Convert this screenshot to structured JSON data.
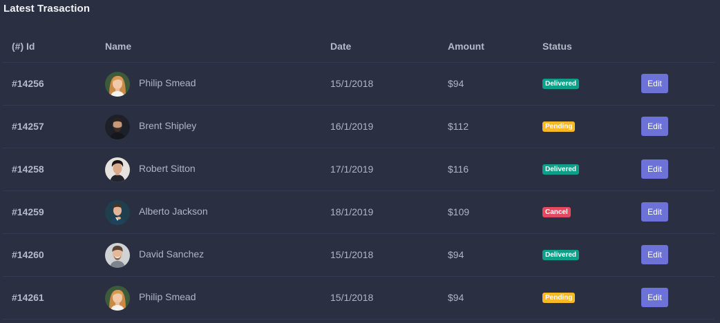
{
  "card": {
    "title": "Latest Trasaction"
  },
  "table": {
    "headers": {
      "id": "(#) Id",
      "name": "Name",
      "date": "Date",
      "amount": "Amount",
      "status": "Status"
    },
    "rows": [
      {
        "id": "#14256",
        "name": "Philip Smead",
        "date": "15/1/2018",
        "amount": "$94",
        "status": "Delivered",
        "status_kind": "delivered",
        "action": "Edit",
        "avatar": "woman-blonde"
      },
      {
        "id": "#14257",
        "name": "Brent Shipley",
        "date": "16/1/2019",
        "amount": "$112",
        "status": "Pending",
        "status_kind": "pending",
        "action": "Edit",
        "avatar": "man-dark-beard"
      },
      {
        "id": "#14258",
        "name": "Robert Sitton",
        "date": "17/1/2019",
        "amount": "$116",
        "status": "Delivered",
        "status_kind": "delivered",
        "action": "Edit",
        "avatar": "man-asian"
      },
      {
        "id": "#14259",
        "name": "Alberto Jackson",
        "date": "18/1/2019",
        "amount": "$109",
        "status": "Cancel",
        "status_kind": "cancel",
        "action": "Edit",
        "avatar": "man-blue-shirt"
      },
      {
        "id": "#14260",
        "name": "David Sanchez",
        "date": "15/1/2018",
        "amount": "$94",
        "status": "Delivered",
        "status_kind": "delivered",
        "action": "Edit",
        "avatar": "man-smiling"
      },
      {
        "id": "#14261",
        "name": "Philip Smead",
        "date": "15/1/2018",
        "amount": "$94",
        "status": "Pending",
        "status_kind": "pending",
        "action": "Edit",
        "avatar": "woman-blonde"
      }
    ]
  },
  "colors": {
    "background": "#2a2f41",
    "delivered": "#0e9f8a",
    "pending": "#f7b924",
    "cancel": "#e44a5f",
    "edit_button": "#6c72d8"
  }
}
